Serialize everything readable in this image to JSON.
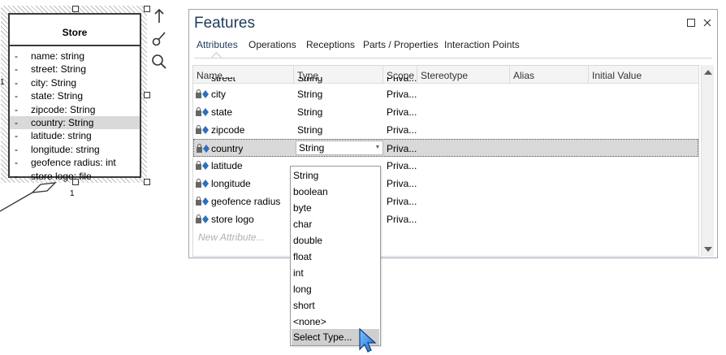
{
  "diagram": {
    "class_name": "Store",
    "attributes": [
      {
        "marker": "-",
        "text": "name: string"
      },
      {
        "marker": "-",
        "text": "street: String"
      },
      {
        "marker": "-",
        "text": "city: String"
      },
      {
        "marker": "-",
        "text": "state: String"
      },
      {
        "marker": "-",
        "text": "zipcode: String"
      },
      {
        "marker": "-",
        "text": "country: String"
      },
      {
        "marker": "-",
        "text": "latitude: string"
      },
      {
        "marker": "-",
        "text": "longitude: string"
      },
      {
        "marker": "-",
        "text": "geofence radius: int"
      },
      {
        "marker": "-",
        "text": "store logo: file"
      }
    ],
    "selected_attribute": "country: String",
    "multiplicity_left": "1",
    "multiplicity_bottom": "1",
    "tool_icons": [
      "arrow-up-icon",
      "brush-icon",
      "magnifier-icon"
    ]
  },
  "window": {
    "title": "Features",
    "tabs": [
      {
        "label": "Attributes",
        "active": true
      },
      {
        "label": "Operations"
      },
      {
        "label": "Receptions"
      },
      {
        "label": "Parts / Properties"
      },
      {
        "label": "Interaction Points"
      }
    ],
    "columns": {
      "name": "Name",
      "type": "Type",
      "scope": "Scope",
      "stereotype": "Stereotype",
      "alias": "Alias",
      "initial_value": "Initial Value"
    },
    "partial_row": {
      "name": "street",
      "type": "String",
      "scope": "Priva..."
    },
    "rows": [
      {
        "name": "city",
        "type": "String",
        "scope": "Priva..."
      },
      {
        "name": "state",
        "type": "String",
        "scope": "Priva..."
      },
      {
        "name": "zipcode",
        "type": "String",
        "scope": "Priva..."
      },
      {
        "name": "country",
        "type": "String",
        "scope": "Priva..."
      },
      {
        "name": "latitude",
        "type": "",
        "scope": "Priva..."
      },
      {
        "name": "longitude",
        "type": "",
        "scope": "Priva..."
      },
      {
        "name": "geofence radius",
        "type": "",
        "scope": "Priva..."
      },
      {
        "name": "store logo",
        "type": "",
        "scope": "Priva..."
      }
    ],
    "new_row_placeholder": "New Attribute...",
    "editing_type_value": "String"
  },
  "type_dropdown": {
    "options": [
      "String",
      "boolean",
      "byte",
      "char",
      "double",
      "float",
      "int",
      "long",
      "short",
      "<none>",
      "Select Type..."
    ],
    "highlighted": "Select Type..."
  },
  "colors": {
    "title": "#1e3a5a",
    "selection": "#d9d9d9",
    "hatch": "#bdbdbd",
    "icon_blue": "#2f6fc0"
  }
}
